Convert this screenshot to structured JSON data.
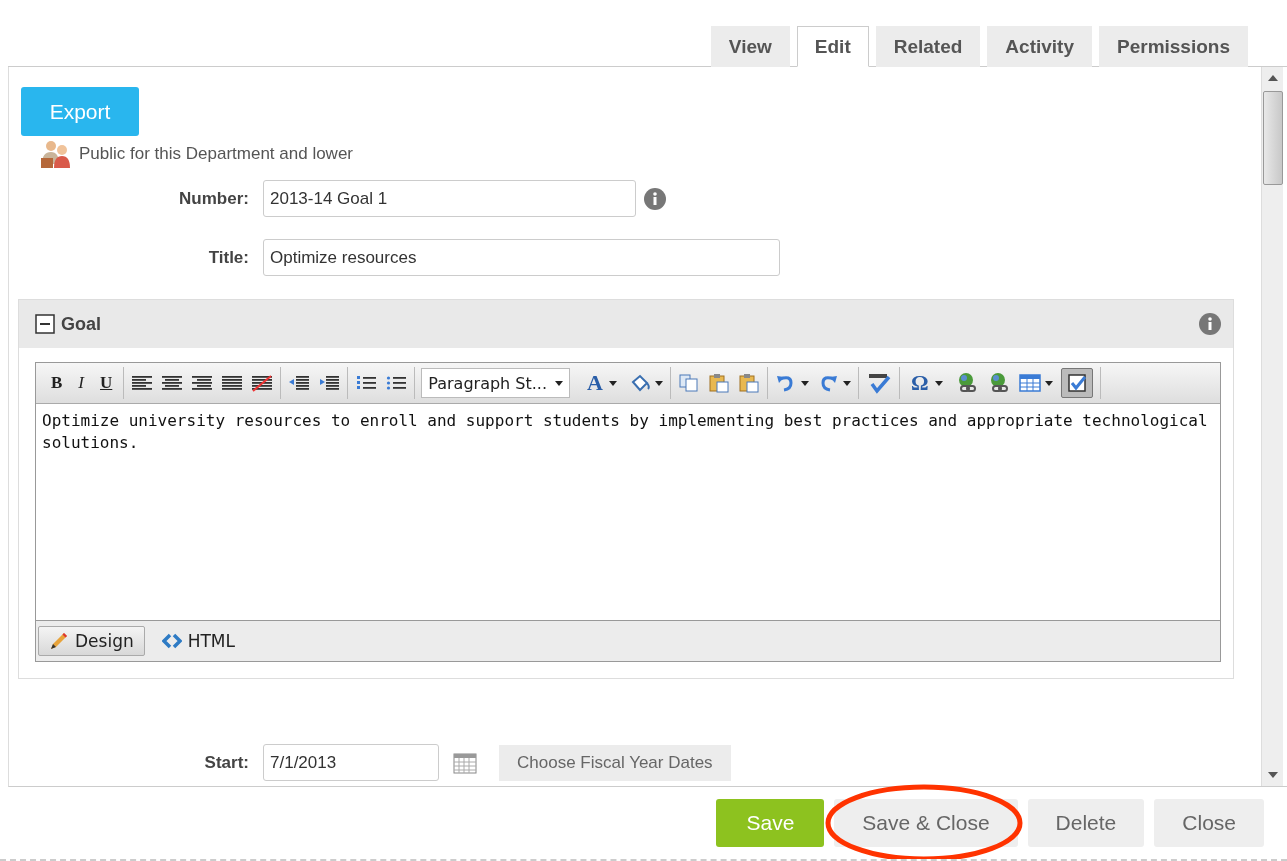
{
  "tabs": [
    {
      "label": "View",
      "selected": false
    },
    {
      "label": "Edit",
      "selected": true
    },
    {
      "label": "Related",
      "selected": false
    },
    {
      "label": "Activity",
      "selected": false
    },
    {
      "label": "Permissions",
      "selected": false
    }
  ],
  "export_button": "Export",
  "visibility": "Public for this Department and lower",
  "fields": [
    {
      "label": "Number:",
      "value": "2013-14 Goal 1",
      "info": true
    },
    {
      "label": "Title:",
      "value": "Optimize resources",
      "info": false
    }
  ],
  "goal_panel": {
    "title": "Goal",
    "expanded": true,
    "editor": {
      "format_buttons": [
        "B",
        "I",
        "U"
      ],
      "paragraph_style": "Paragraph St...",
      "font_color_label": "A",
      "symbol_label": "Ω",
      "toggle_pressed": true,
      "content": "Optimize university resources to enroll and support students by implementing best practices and appropriate technological solutions.",
      "modes": [
        {
          "label": "Design",
          "selected": true
        },
        {
          "label": "HTML",
          "selected": false
        }
      ]
    }
  },
  "start": {
    "label": "Start:",
    "value": "7/1/2013",
    "button": "Choose Fiscal Year Dates"
  },
  "footer_buttons": [
    {
      "label": "Save",
      "kind": "primary",
      "circled": false
    },
    {
      "label": "Save & Close",
      "kind": "secondary",
      "circled": true
    },
    {
      "label": "Delete",
      "kind": "secondary",
      "circled": false
    },
    {
      "label": "Close",
      "kind": "secondary",
      "circled": false
    }
  ]
}
